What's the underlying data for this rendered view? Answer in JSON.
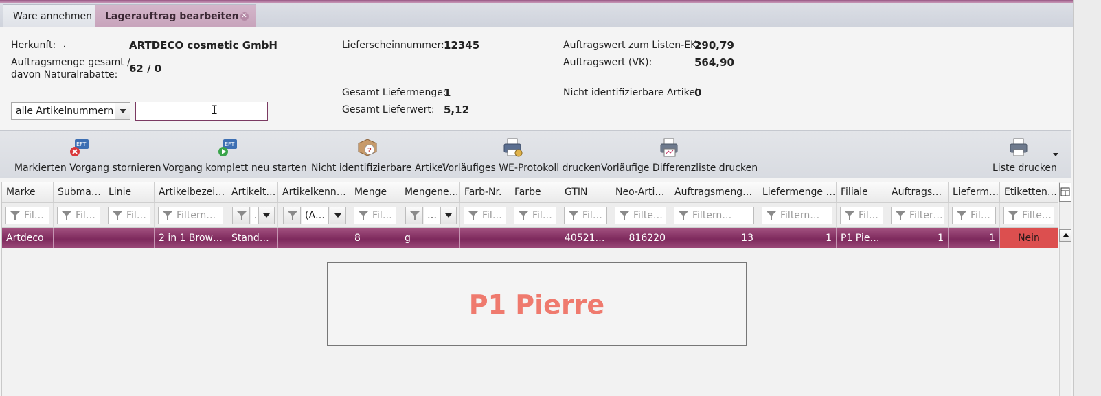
{
  "tabs": [
    {
      "label": "Ware annehmen"
    },
    {
      "label": "Lagerauftrag bearbeiten"
    }
  ],
  "info": {
    "herkunft_label": "Herkunft:",
    "herkunft_value": "ARTDECO cosmetic GmbH",
    "auftragsmenge_label_1": "Auftragsmenge gesamt /",
    "auftragsmenge_label_2": "davon Naturalrabatte:",
    "auftragsmenge_value": "62 / 0",
    "lieferschein_label": "Lieferscheinnummer:",
    "lieferschein_value": "12345",
    "gesamt_liefermenge_label": "Gesamt Liefermenge:",
    "gesamt_liefermenge_value": "1",
    "gesamt_lieferwert_label": "Gesamt Lieferwert:",
    "gesamt_lieferwert_value": "5,12",
    "listen_ek_label": "Auftragswert zum Listen-EK:",
    "listen_ek_value": "290,79",
    "vk_label": "Auftragswert (VK):",
    "vk_value": "564,90",
    "nicht_ident_label": "Nicht identifizierbare Artikel:",
    "nicht_ident_value": "0"
  },
  "filter": {
    "select_value": "alle Artikelnummern",
    "search_value": ""
  },
  "toolbar": {
    "storno": "Markierten Vorgang stornieren",
    "neu_starten": "Vorgang komplett neu starten",
    "nicht_ident": "Nicht identifizierbare Artikel",
    "we_protokoll": "Vorläufiges WE-Protokoll drucken",
    "differenzliste": "Vorläufige Differenzliste drucken",
    "liste_drucken": "Liste drucken"
  },
  "grid": {
    "headers": [
      "Marke",
      "Submarke",
      "Linie",
      "Artikelbezeic…",
      "Artikeltyp",
      "Artikelkennz…",
      "Menge",
      "Mengenei…",
      "Farb-Nr.",
      "Farbe",
      "GTIN",
      "Neo-Artik…",
      "Auftragsmenge …",
      "Liefermenge g…",
      "Filiale",
      "Auftragsm…",
      "Lieferm…",
      "Etikettend…"
    ],
    "filters": [
      "Fil…",
      "Fil…",
      "Fil…",
      "Filtern…",
      ".",
      "(A…",
      "Fil…",
      "…",
      "Fil…",
      "Fil…",
      "Fil…",
      "Filte…",
      "Filtern…",
      "Filtern…",
      "Fil…",
      "Filter…",
      "Fil…",
      "Filte…"
    ],
    "row": [
      "Artdeco",
      "",
      "",
      "2 in 1 Brow …",
      "Standard",
      "",
      "8",
      "g",
      "",
      "",
      "405213…",
      "816220",
      "13",
      "1",
      "P1 Pierre",
      "1",
      "1",
      "Nein"
    ]
  },
  "overlay_text": "P1 Pierre"
}
